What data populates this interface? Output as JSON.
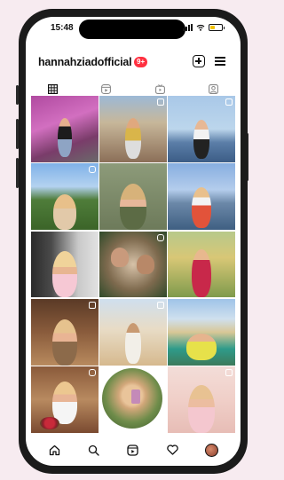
{
  "status_bar": {
    "time": "15:48"
  },
  "profile": {
    "username": "hannahziadofficial",
    "notification_badge": "9+"
  },
  "tabs": [
    {
      "icon": "grid-icon",
      "active": true
    },
    {
      "icon": "reels-icon",
      "active": false
    },
    {
      "icon": "tv-icon",
      "active": false
    },
    {
      "icon": "tagged-icon",
      "active": false
    }
  ],
  "posts": [
    {
      "scene": "woman under bougainvillea",
      "overlay": "none"
    },
    {
      "scene": "woman on istanbul street",
      "overlay": "multi"
    },
    {
      "scene": "woman at sea shore",
      "overlay": "multi"
    },
    {
      "scene": "woman on mountain",
      "overlay": "reel"
    },
    {
      "scene": "woman portrait in green",
      "overlay": "none"
    },
    {
      "scene": "woman on pier in red skirt",
      "overlay": "none"
    },
    {
      "scene": "woman in car",
      "overlay": "none"
    },
    {
      "scene": "friends group selfie",
      "overlay": "reel"
    },
    {
      "scene": "woman in red dress tropical",
      "overlay": "none"
    },
    {
      "scene": "woman at cafe",
      "overlay": "multi"
    },
    {
      "scene": "woman in desert",
      "overlay": "multi"
    },
    {
      "scene": "woman in yellow dress at pool",
      "overlay": "none"
    },
    {
      "scene": "woman with roses",
      "overlay": "reel"
    },
    {
      "scene": "woman circle video",
      "overlay": "none"
    },
    {
      "scene": "woman in pink",
      "overlay": "multi"
    }
  ],
  "bottom_nav": [
    {
      "icon": "home-icon"
    },
    {
      "icon": "search-icon"
    },
    {
      "icon": "reels-nav-icon"
    },
    {
      "icon": "heart-icon"
    },
    {
      "icon": "profile-avatar-icon"
    }
  ],
  "colors": {
    "badge": "#ff3040",
    "background": "#f7ebf0",
    "frame": "#1b1b1b"
  }
}
